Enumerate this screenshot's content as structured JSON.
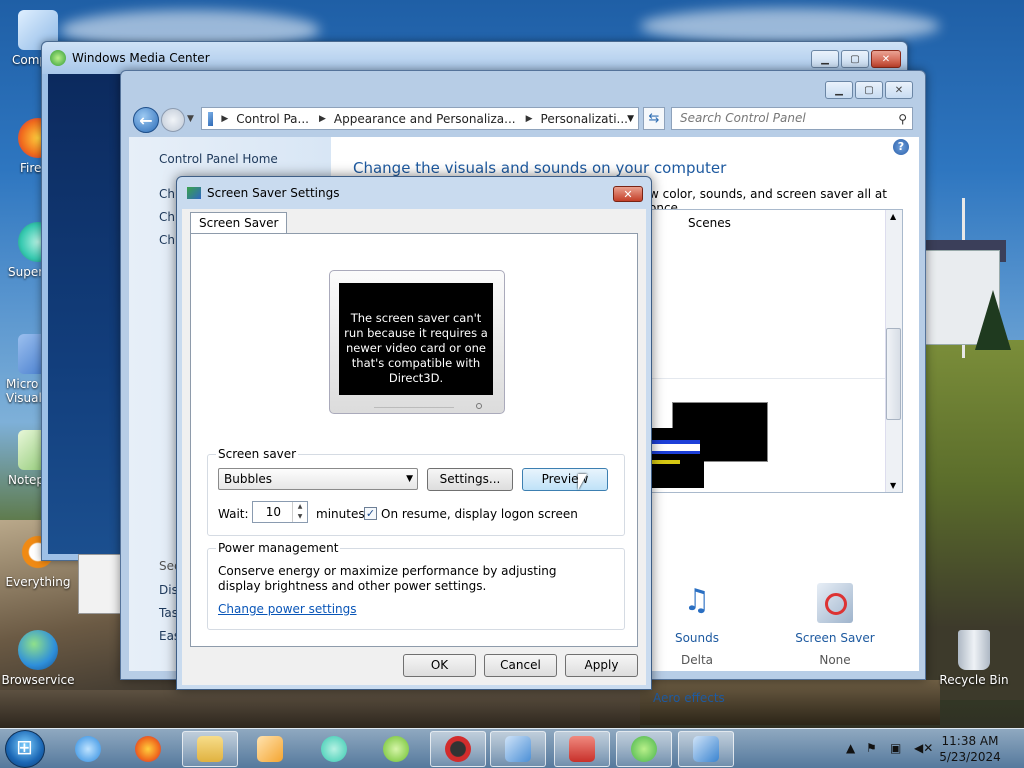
{
  "desktop": {
    "icons": [
      {
        "label": "Comp",
        "glyph_color": "#8fb9e6"
      },
      {
        "label": "Fire",
        "glyph_color": "#f06a1d"
      },
      {
        "label": "Supern",
        "glyph_color": "#36c9b0"
      },
      {
        "label": "Micro\nVisual",
        "glyph_color": "#3b74c9"
      },
      {
        "label": "Notep",
        "glyph_color": "#86c46a"
      },
      {
        "label": "Everything",
        "glyph_color": "#f08a14"
      },
      {
        "label": "Browservice",
        "glyph_color": "#2e8fdb"
      },
      {
        "label": "Recycle Bin",
        "glyph_color": "#cfd7e0"
      }
    ]
  },
  "wmc": {
    "title": "Windows Media Center"
  },
  "control_panel": {
    "breadcrumbs": [
      "Control Pa...",
      "Appearance and Personaliza...",
      "Personalizati..."
    ],
    "search_placeholder": "Search Control Panel",
    "home_link": "Control Panel Home",
    "side_links": [
      "Ch",
      "Ch",
      "Ch"
    ],
    "see_also_links": [
      "See",
      "Dis",
      "Tas",
      "Eas"
    ],
    "heading": "Change the visuals and sounds on your computer",
    "subheading": "w color, sounds, and screen saver all at once.",
    "themes_label": "Scenes",
    "tiles": [
      {
        "title": "Sounds",
        "value": "Delta",
        "icon": "music-notes-icon"
      },
      {
        "title": "Screen Saver",
        "value": "None",
        "icon": "screen-saver-icon"
      }
    ],
    "aero_link": "Aero effects"
  },
  "dialog": {
    "title": "Screen Saver Settings",
    "tab": "Screen Saver",
    "preview_message": "The screen saver can't run because it requires a newer video card or one that's compatible with Direct3D.",
    "screen_saver_group": "Screen saver",
    "selected_saver": "Bubbles",
    "settings_button": "Settings...",
    "preview_button": "Preview",
    "wait_label": "Wait:",
    "wait_minutes": "10",
    "minutes_label": "minutes",
    "resume_checked": true,
    "resume_label": "On resume, display logon screen",
    "power_group": "Power management",
    "power_text": "Conserve energy or maximize performance by adjusting display brightness and other power settings.",
    "power_link": "Change power settings",
    "ok": "OK",
    "cancel": "Cancel",
    "apply": "Apply"
  },
  "taskbar": {
    "items": [
      {
        "name": "internet-explorer",
        "color": "#2a8ae0"
      },
      {
        "name": "firefox",
        "color": "#f06a1d"
      },
      {
        "name": "file-explorer",
        "color": "#e9c45b"
      },
      {
        "name": "media-player",
        "color": "#f4a531"
      },
      {
        "name": "supernova",
        "color": "#36c9b0"
      },
      {
        "name": "green-app",
        "color": "#6cbf2d"
      },
      {
        "name": "bird-app",
        "color": "#d22c2c"
      },
      {
        "name": "control-panel",
        "color": "#4b8fd6"
      },
      {
        "name": "toolbox",
        "color": "#c8302a"
      },
      {
        "name": "media-center",
        "color": "#46b34b"
      },
      {
        "name": "screen-saver-settings",
        "color": "#3a84d0"
      }
    ],
    "time": "11:38 AM",
    "date": "5/23/2024"
  }
}
